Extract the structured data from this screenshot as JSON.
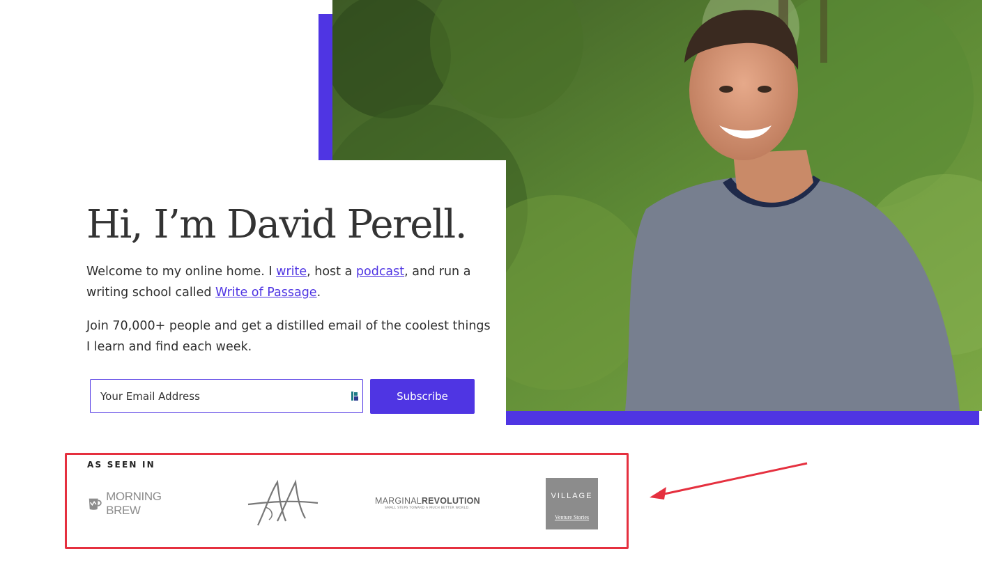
{
  "hero": {
    "headline": "Hi, I’m David Perell.",
    "intro_before_write": "Welcome to my online home. I ",
    "write_link": "write",
    "intro_before_podcast": ", host a ",
    "podcast_link": "podcast",
    "intro_before_school": ", and run a writing school called ",
    "school_link": "Write of Passage",
    "intro_end": ".",
    "join_text": "Join 70,000+ people and get a distilled email of the coolest things I learn and find each week."
  },
  "signup": {
    "email_placeholder": "Your Email Address",
    "subscribe_label": "Subscribe"
  },
  "as_seen_in": {
    "label": "AS SEEN IN",
    "logos": {
      "morning_brew": {
        "text": "MORNING BREW"
      },
      "aa": {},
      "marginal_revolution": {
        "part1": "MARGINAL",
        "part2": "REVOLUTION",
        "tagline": "SMALL STEPS TOWARD A MUCH BETTER WORLD."
      },
      "village": {
        "title": "VILLAGE",
        "subtitle": "Venture Stories"
      }
    }
  },
  "colors": {
    "accent": "#4f35e3",
    "highlight_box": "#e5303f"
  }
}
